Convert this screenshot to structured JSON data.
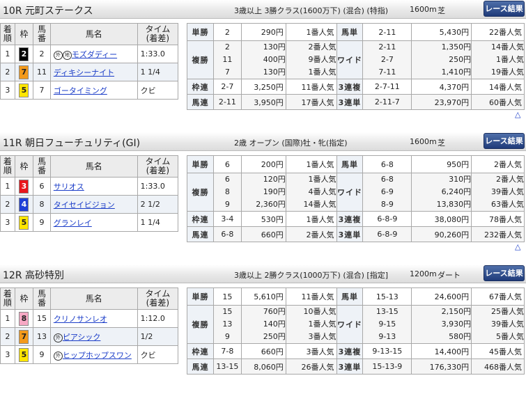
{
  "header_cols": {
    "finish": "着\n順",
    "waku": "枠",
    "umaban": "馬\n番",
    "name": "馬名",
    "time": "タイム\n(着差)"
  },
  "result_button": "レース結果",
  "up_icon": "△",
  "races": [
    {
      "title": "10R 元町ステークス",
      "conditions": "3歳以上 3勝クラス(1600万下) (混合) (特指)",
      "distance": "1600m",
      "surface": "芝",
      "finishers": [
        {
          "pos": "1",
          "waku": "2",
          "wcolor": "#000000",
          "wtext": "#ffffff",
          "num": "2",
          "tags": [
            "外",
            "地"
          ],
          "name": "モズダディー",
          "time": "1:33.0"
        },
        {
          "pos": "2",
          "waku": "7",
          "wcolor": "#f39a1c",
          "wtext": "#222222",
          "num": "11",
          "tags": [],
          "name": "ディキシーナイト",
          "time": "1 1/4"
        },
        {
          "pos": "3",
          "waku": "5",
          "wcolor": "#ffe600",
          "wtext": "#222222",
          "num": "7",
          "tags": [],
          "name": "ゴータイミング",
          "time": "クビ"
        }
      ],
      "payouts": {
        "tansho": {
          "label": "単勝",
          "combo": "2",
          "amount": "290円",
          "pop": "1番人気"
        },
        "fukusho": {
          "label": "複勝",
          "combos": [
            "2",
            "11",
            "7"
          ],
          "amounts": [
            "130円",
            "400円",
            "130円"
          ],
          "pops": [
            "2番人気",
            "9番人気",
            "1番人気"
          ]
        },
        "wakuren": {
          "label": "枠連",
          "combo": "2-7",
          "amount": "3,250円",
          "pop": "11番人気"
        },
        "umaren": {
          "label": "馬連",
          "combo": "2-11",
          "amount": "3,950円",
          "pop": "17番人気"
        },
        "umatan": {
          "label": "馬単",
          "combo": "2-11",
          "amount": "5,430円",
          "pop": "22番人気"
        },
        "wide": {
          "label": "ワイド",
          "combos": [
            "2-11",
            "2-7",
            "7-11"
          ],
          "amounts": [
            "1,350円",
            "250円",
            "1,410円"
          ],
          "pops": [
            "14番人気",
            "1番人気",
            "19番人気"
          ]
        },
        "sanrenpuku": {
          "label": "3連複",
          "combo": "2-7-11",
          "amount": "4,370円",
          "pop": "14番人気"
        },
        "sanrentan": {
          "label": "3連単",
          "combo": "2-11-7",
          "amount": "23,970円",
          "pop": "60番人気"
        }
      }
    },
    {
      "title": "11R 朝日フューチュリティ(GⅠ)",
      "conditions": "2歳 オープン (国際)牡・牝(指定)",
      "distance": "1600m",
      "surface": "芝",
      "finishers": [
        {
          "pos": "1",
          "waku": "3",
          "wcolor": "#e8161b",
          "wtext": "#ffffff",
          "num": "6",
          "tags": [],
          "name": "サリオス",
          "time": "1:33.0"
        },
        {
          "pos": "2",
          "waku": "4",
          "wcolor": "#1f3fd6",
          "wtext": "#ffffff",
          "num": "8",
          "tags": [],
          "name": "タイセイビジョン",
          "time": "2 1/2"
        },
        {
          "pos": "3",
          "waku": "5",
          "wcolor": "#ffe600",
          "wtext": "#222222",
          "num": "9",
          "tags": [],
          "name": "グランレイ",
          "time": "1 1/4"
        }
      ],
      "payouts": {
        "tansho": {
          "label": "単勝",
          "combo": "6",
          "amount": "200円",
          "pop": "1番人気"
        },
        "fukusho": {
          "label": "複勝",
          "combos": [
            "6",
            "8",
            "9"
          ],
          "amounts": [
            "120円",
            "190円",
            "2,360円"
          ],
          "pops": [
            "1番人気",
            "4番人気",
            "14番人気"
          ]
        },
        "wakuren": {
          "label": "枠連",
          "combo": "3-4",
          "amount": "530円",
          "pop": "1番人気"
        },
        "umaren": {
          "label": "馬連",
          "combo": "6-8",
          "amount": "660円",
          "pop": "2番人気"
        },
        "umatan": {
          "label": "馬単",
          "combo": "6-8",
          "amount": "950円",
          "pop": "2番人気"
        },
        "wide": {
          "label": "ワイド",
          "combos": [
            "6-8",
            "6-9",
            "8-9"
          ],
          "amounts": [
            "310円",
            "6,240円",
            "13,830円"
          ],
          "pops": [
            "2番人気",
            "39番人気",
            "63番人気"
          ]
        },
        "sanrenpuku": {
          "label": "3連複",
          "combo": "6-8-9",
          "amount": "38,080円",
          "pop": "78番人気"
        },
        "sanrentan": {
          "label": "3連単",
          "combo": "6-8-9",
          "amount": "90,260円",
          "pop": "232番人気"
        }
      }
    },
    {
      "title": "12R 高砂特別",
      "conditions": "3歳以上 2勝クラス(1000万下) (混合) [指定]",
      "distance": "1200m",
      "surface": "ダート",
      "finishers": [
        {
          "pos": "1",
          "waku": "8",
          "wcolor": "#f7a8c4",
          "wtext": "#222222",
          "num": "15",
          "tags": [],
          "name": "クリノサンレオ",
          "time": "1:12.0"
        },
        {
          "pos": "2",
          "waku": "7",
          "wcolor": "#f39a1c",
          "wtext": "#222222",
          "num": "13",
          "tags": [
            "外"
          ],
          "name": "ピアシック",
          "time": "1/2"
        },
        {
          "pos": "3",
          "waku": "5",
          "wcolor": "#ffe600",
          "wtext": "#222222",
          "num": "9",
          "tags": [
            "外"
          ],
          "name": "ヒップホップスワン",
          "time": "クビ"
        }
      ],
      "payouts": {
        "tansho": {
          "label": "単勝",
          "combo": "15",
          "amount": "5,610円",
          "pop": "11番人気"
        },
        "fukusho": {
          "label": "複勝",
          "combos": [
            "15",
            "13",
            "9"
          ],
          "amounts": [
            "760円",
            "140円",
            "250円"
          ],
          "pops": [
            "10番人気",
            "1番人気",
            "3番人気"
          ]
        },
        "wakuren": {
          "label": "枠連",
          "combo": "7-8",
          "amount": "660円",
          "pop": "3番人気"
        },
        "umaren": {
          "label": "馬連",
          "combo": "13-15",
          "amount": "8,060円",
          "pop": "26番人気"
        },
        "umatan": {
          "label": "馬単",
          "combo": "15-13",
          "amount": "24,600円",
          "pop": "67番人気"
        },
        "wide": {
          "label": "ワイド",
          "combos": [
            "13-15",
            "9-15",
            "9-13"
          ],
          "amounts": [
            "2,150円",
            "3,930円",
            "580円"
          ],
          "pops": [
            "25番人気",
            "39番人気",
            "5番人気"
          ]
        },
        "sanrenpuku": {
          "label": "3連複",
          "combo": "9-13-15",
          "amount": "14,400円",
          "pop": "45番人気"
        },
        "sanrentan": {
          "label": "3連単",
          "combo": "15-13-9",
          "amount": "176,330円",
          "pop": "468番人気"
        }
      }
    }
  ]
}
